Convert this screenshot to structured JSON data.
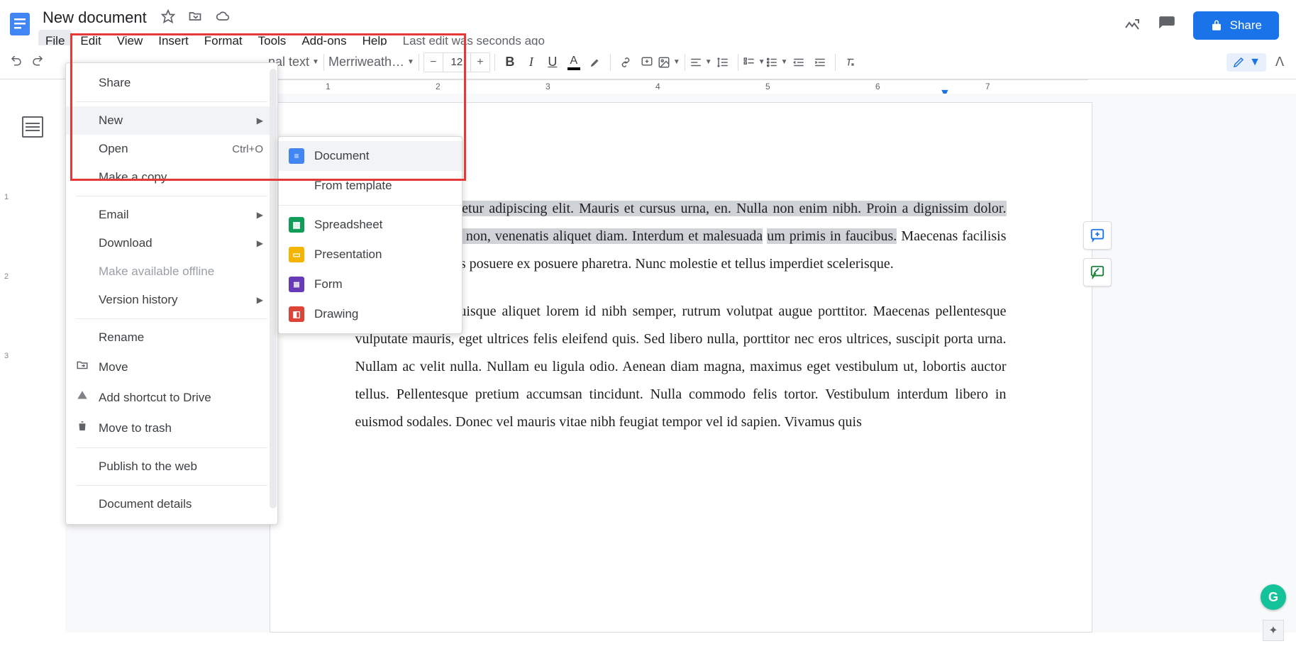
{
  "header": {
    "title": "New document",
    "last_edit": "Last edit was seconds ago",
    "share_label": "Share",
    "menus": [
      "File",
      "Edit",
      "View",
      "Insert",
      "Format",
      "Tools",
      "Add-ons",
      "Help"
    ]
  },
  "toolbar": {
    "style_label": "nal text",
    "font_label": "Merriweath…",
    "font_size": "12",
    "pen_arrow": "▼"
  },
  "ruler": {
    "marks": [
      "1",
      "2",
      "3",
      "4",
      "5",
      "6",
      "7"
    ]
  },
  "vruler": [
    "1",
    "2",
    "3"
  ],
  "file_menu": {
    "share": "Share",
    "new": "New",
    "open": "Open",
    "open_kbd": "Ctrl+O",
    "make_copy": "Make a copy",
    "email": "Email",
    "download": "Download",
    "offline": "Make available offline",
    "version_history": "Version history",
    "rename": "Rename",
    "move": "Move",
    "add_shortcut": "Add shortcut to Drive",
    "trash": "Move to trash",
    "publish": "Publish to the web",
    "details": "Document details"
  },
  "new_submenu": {
    "document": "Document",
    "from_template": "From template",
    "spreadsheet": "Spreadsheet",
    "presentation": "Presentation",
    "form": "Form",
    "drawing": "Drawing"
  },
  "doc": {
    "p1_sel": "r sit amet, consectetur adipiscing elit. Mauris et cursus urna, en. Nulla non enim nibh. Proin a dignissim dolor. Nunc quam d felis non, venenatis aliquet diam. Interdum et malesuada",
    "p1_sel_tail": "um primis in faucibus.",
    "p1_rest": " Maecenas facilisis dignissim erat, quis posuere ex posuere pharetra. Nunc molestie et tellus imperdiet scelerisque.",
    "p2": "In a urna arcu. Quisque aliquet lorem id nibh semper, rutrum volutpat augue porttitor. Maecenas pellentesque vulputate mauris, eget ultrices felis eleifend quis. Sed libero nulla, porttitor nec eros ultrices, suscipit porta urna. Nullam ac velit nulla. Nullam eu ligula odio. Aenean diam magna, maximus eget vestibulum ut, lobortis auctor tellus. Pellentesque pretium accumsan tincidunt. Nulla commodo felis tortor. Vestibulum interdum libero in euismod sodales. Donec vel mauris vitae nibh feugiat tempor vel id sapien. Vivamus quis"
  },
  "colors": {
    "docs_blue": "#4285f4",
    "sheets_green": "#0f9d58",
    "slides_yellow": "#f4b400",
    "forms_purple": "#673ab7",
    "drawings_red": "#db4437"
  }
}
